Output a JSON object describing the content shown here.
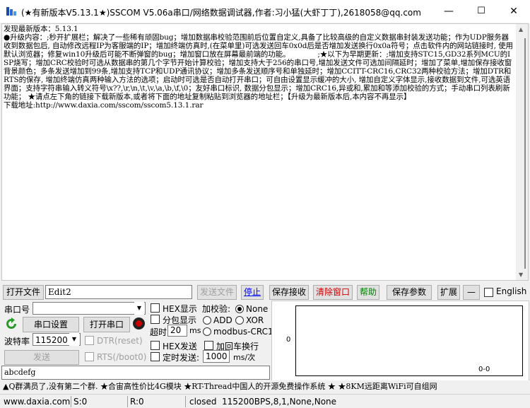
{
  "titlebar": {
    "title": "(★有新版本V5.13.1★)SSCOM V5.06a串口/网络数据调试器,作者:习小猛(大虾丁丁),2618058@qq.com",
    "minimize": "—",
    "maximize": "☐",
    "close": "✕"
  },
  "receive": {
    "text": "发现最新版本：5.13.1\n●升级内容：;秒开扩展栏；解决了一些稀有顽固bug；增加数据串校验范围前后位置自定义,具备了比较高级的自定义数据串封装发送功能；作为UDP服务器收到数据包后, 自动修改远程IP为客服端的IP；增加终端仿真时,(在菜单里)可选发送回车0x0d后是否增加发送换行0x0a符号；点击软件内的网站链接时, 使用默认浏览器；修复win10升级后可能不断弹窗的bug；增加窗口放在屏幕最前端的功能。            ;★以下为早期更新：;增加支持STC15,GD32系列MCU的ISP烧写；增加CRC校验时可选从数据串的第几个字节开始计算校验；增加支持大于256的串口号,增加发送文件可选加间隔延时；增加了菜单,增加保存接收窗背景颜色；多条发送增加到99条,增加支持TCP和UDP通讯协议；增加多条发送顺序号和单独延时；增加CCITT-CRC16,CRC32两种校验方法；增加DTR和RTS的保存, 增加终端仿真两种输入方法的选项；启动时可选是否自动打开串口；可自由设置显示缓冲的大小, 增加自定义字体显示,接收数据到文件,可选英语界面；支持字符串输入转义符号\\x??,\\r,\\n,\\t,\\v,\\a,\\b,\\f,\\0；友好串口标识, 数据分包显示；增加CRC16,异或和,累加和等添加校验的方式；手动串口列表刷新功能； ★请点左下角的链接下载新版本,或者将下面的地址复制粘贴到浏览器的地址栏；【升级为最新版本后,本内容不再显示】\n下载地址:http://www.daxia.com/sscom/sscom5.13.1.rar"
  },
  "toolbar": {
    "open_file": "打开文件",
    "file_path": "Edit2",
    "send_file": "发送文件",
    "stop": "停止",
    "save_recv": "保存接收",
    "clear_window": "清除窗口",
    "help": "帮助",
    "save_params": "保存参数",
    "expand": "扩展",
    "collapse": "—",
    "english": "English"
  },
  "serial": {
    "port_label": "串口号",
    "port_value": "",
    "settings_btn": "串口设置",
    "open_btn": "打开串口",
    "baud_label": "波特率",
    "baud_value": "115200",
    "send_btn": "发送",
    "dtr_label": "DTR(reset)",
    "rts_label": "RTS(/boot0)"
  },
  "options": {
    "hex_display": "HEX显示",
    "packet_display": "分包显示",
    "timeout_label": "超时",
    "timeout_value": "20",
    "timeout_unit": "ms",
    "hex_send": "HEX发送",
    "timed_send": "定时发送:",
    "timed_value": "1000",
    "timed_unit": "ms/次",
    "add_crlf": "加回车换行",
    "checksum_label": "加校验:",
    "cs_none": "None",
    "cs_add": "ADD",
    "cs_xor": "XOR",
    "cs_modbus": "modbus-CRC16"
  },
  "send_input": {
    "value": "abcdefg"
  },
  "graph": {
    "y_zero": "0",
    "x_label": "0-0"
  },
  "ad": {
    "text": "▲Q群满员了,没有第二个群. ★合宙高性价比4G模块 ★RT-Thread中国人的开源免费操作系统 ★ ★8KM远距离WiFi可自组网"
  },
  "status": {
    "website": "www.daxia.com",
    "sent": "S:0",
    "received": "R:0",
    "state": "closed",
    "config": "115200BPS,8,1,None,None"
  },
  "colors": {
    "stop_text": "#0000ff",
    "clear_text": "#cc0000",
    "help_text": "#008000"
  }
}
